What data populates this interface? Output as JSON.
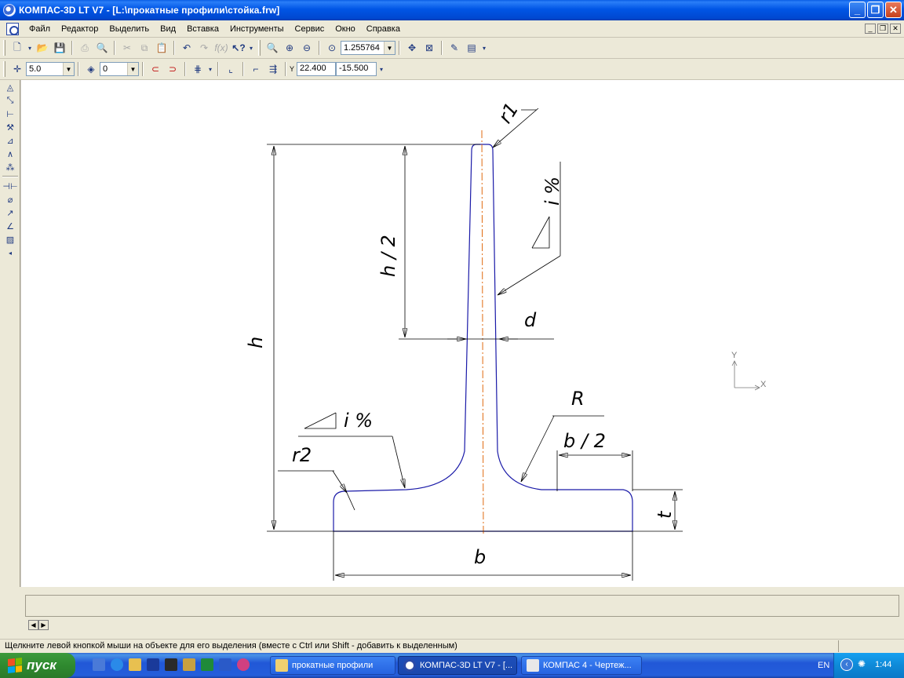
{
  "window": {
    "title": "КОМПАС-3D LT V7 - [L:\\прокатные профили\\стойка.frw]",
    "minimize": "_",
    "maximize": "❐",
    "close": "✕"
  },
  "menu": [
    "Файл",
    "Редактор",
    "Выделить",
    "Вид",
    "Вставка",
    "Инструменты",
    "Сервис",
    "Окно",
    "Справка"
  ],
  "toolbar1": {
    "zoom_value": "1.255764"
  },
  "toolbar2": {
    "step_value": "5.0",
    "layer_value": "0",
    "coord_x": "22.400",
    "coord_y": "-15.500",
    "coord_label": "Y"
  },
  "drawing": {
    "labels": {
      "r1": "r1",
      "slope_top": "i %",
      "half_h": "h / 2",
      "d": "d",
      "h": "h",
      "R": "R",
      "slope_bottom": "i %",
      "half_b": "b / 2",
      "r2": "r2",
      "t": "t",
      "b": "b"
    },
    "axis_x": "X",
    "axis_y": "Y"
  },
  "status_text": "Щелкните левой кнопкой мыши на объекте для его выделения (вместе с Ctrl или Shift - добавить к выделенным)",
  "taskbar": {
    "start_label": "пуск",
    "tasks": [
      "прокатные профили",
      "КОМПАС-3D LT V7 - [...",
      "КОМПАС 4 - Чертеж..."
    ],
    "lang": "EN",
    "clock": "1:44"
  },
  "colors": {
    "profile_line": "#1a1aa8",
    "axis_line": "#e06a10",
    "titlebar": "#0055e5"
  }
}
